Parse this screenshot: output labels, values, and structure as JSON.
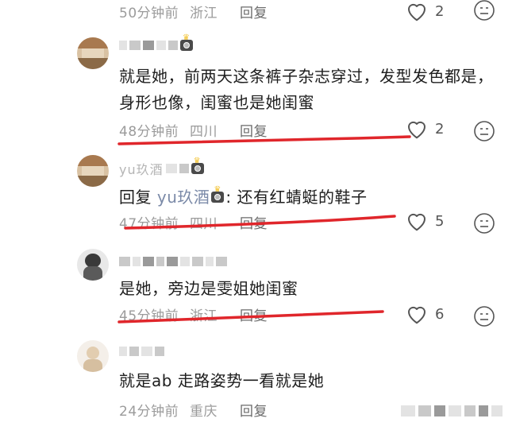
{
  "comments": [
    {
      "id": "c0",
      "meta": {
        "time": "50分钟前",
        "location": "浙江",
        "reply_label": "回复"
      },
      "likes": "2"
    },
    {
      "id": "c1",
      "text": "就是她，前两天这条裤子杂志穿过，发型发色都是，身形也像，闺蜜也是她闺蜜",
      "meta": {
        "time": "48分钟前",
        "location": "四川",
        "reply_label": "回复"
      },
      "likes": "2"
    },
    {
      "id": "c2",
      "username": "yu玖酒",
      "reply_prefix": "回复",
      "reply_to": "yu玖酒",
      "reply_colon": ":",
      "text": "还有红蜻蜓的鞋子",
      "meta": {
        "time": "47分钟前",
        "location": "四川",
        "reply_label": "回复"
      },
      "likes": "5"
    },
    {
      "id": "c3",
      "text": "是她，旁边是雯姐她闺蜜",
      "meta": {
        "time": "45分钟前",
        "location": "浙江",
        "reply_label": "回复"
      },
      "likes": "6"
    },
    {
      "id": "c4",
      "text": "就是ab 走路姿势一看就是她",
      "meta": {
        "time": "24分钟前",
        "location": "重庆",
        "reply_label": "回复"
      }
    }
  ],
  "icons": {
    "like": "heart-outline-icon",
    "dislike": "frown-face-icon",
    "badge": "camera-crown-badge-icon"
  },
  "colors": {
    "annotation_red": "#e0262b",
    "meta_gray": "#9b9b9b",
    "mention_blue": "#7b8aa8"
  }
}
